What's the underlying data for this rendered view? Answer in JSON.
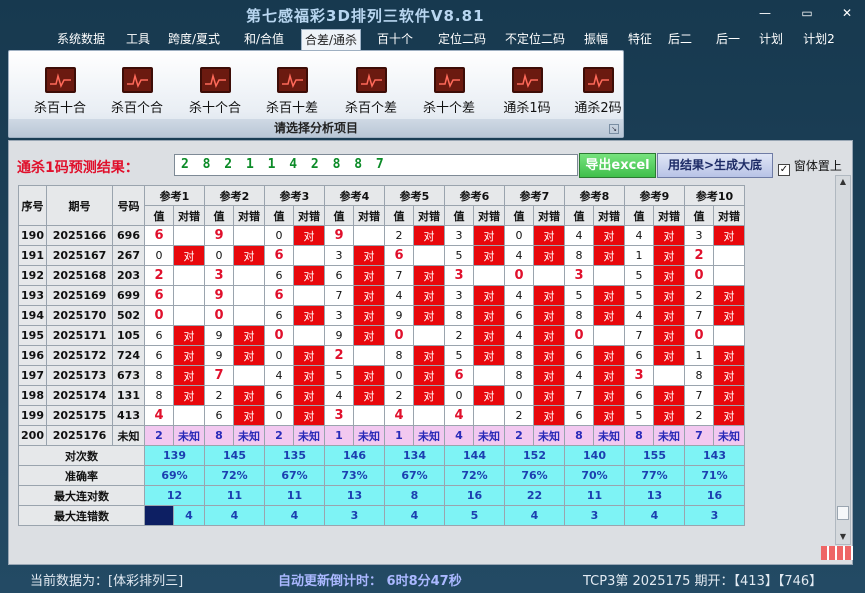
{
  "app": {
    "title": "第七感福彩3D排列三软件V8.81",
    "window_controls": [
      "—",
      "▭",
      "✕"
    ]
  },
  "menu": [
    {
      "label": "系统数据",
      "active": false
    },
    {
      "label": "工具",
      "active": false
    },
    {
      "label": "跨度/夏式",
      "active": false
    },
    {
      "label": "和/合值",
      "active": false
    },
    {
      "label": "合差/通杀",
      "active": true
    },
    {
      "label": "百十个",
      "active": false
    },
    {
      "label": "定位二码",
      "active": false
    },
    {
      "label": "不定位二码",
      "active": false
    },
    {
      "label": "振幅",
      "active": false
    },
    {
      "label": "特征",
      "active": false
    },
    {
      "label": "后二",
      "active": false
    },
    {
      "label": "后一",
      "active": false
    },
    {
      "label": "计划",
      "active": false
    },
    {
      "label": "计划2",
      "active": false
    }
  ],
  "ribbon": {
    "buttons": [
      "杀百十合",
      "杀百个合",
      "杀十个合",
      "杀百十差",
      "杀百个差",
      "杀十个差",
      "通杀1码",
      "通杀2码"
    ],
    "group_label": "请选择分析项目",
    "icon": "chart-icon"
  },
  "prediction": {
    "label": "通杀1码预测结果：",
    "digits": "2 8 2 1 1 4 2 8 8 7",
    "excel_button": "导出excel",
    "generate_button": "用结果>生成大底",
    "pin_checkbox": {
      "label": "窗体置上",
      "checked": true
    }
  },
  "table": {
    "headers": {
      "seq": "序号",
      "period": "期号",
      "code": "号码",
      "ref_prefix": "参考",
      "value": "值",
      "check": "对错"
    },
    "ref_groups": [
      "参考1",
      "参考2",
      "参考3",
      "参考4",
      "参考5",
      "参考6",
      "参考7",
      "参考8",
      "参考9",
      "参考10"
    ],
    "hit_label": "对",
    "rows": [
      {
        "seq": "190",
        "period": "2025166",
        "code": "696",
        "refs": [
          [
            "6",
            0
          ],
          [
            "9",
            0
          ],
          [
            "0",
            1
          ],
          [
            "9",
            0
          ],
          [
            "2",
            1
          ],
          [
            "3",
            1
          ],
          [
            "0",
            1
          ],
          [
            "4",
            1
          ],
          [
            "4",
            1
          ],
          [
            "3",
            1
          ]
        ]
      },
      {
        "seq": "191",
        "period": "2025167",
        "code": "267",
        "refs": [
          [
            "0",
            1
          ],
          [
            "0",
            1
          ],
          [
            "6",
            0
          ],
          [
            "3",
            1
          ],
          [
            "6",
            0
          ],
          [
            "5",
            1
          ],
          [
            "4",
            1
          ],
          [
            "8",
            1
          ],
          [
            "1",
            1
          ],
          [
            "2",
            0
          ]
        ]
      },
      {
        "seq": "192",
        "period": "2025168",
        "code": "203",
        "refs": [
          [
            "2",
            0
          ],
          [
            "3",
            0
          ],
          [
            "6",
            1
          ],
          [
            "6",
            1
          ],
          [
            "7",
            1
          ],
          [
            "3",
            0
          ],
          [
            "0",
            0
          ],
          [
            "3",
            0
          ],
          [
            "5",
            1
          ],
          [
            "0",
            0
          ]
        ]
      },
      {
        "seq": "193",
        "period": "2025169",
        "code": "699",
        "refs": [
          [
            "6",
            0
          ],
          [
            "9",
            0
          ],
          [
            "6",
            0
          ],
          [
            "7",
            1
          ],
          [
            "4",
            1
          ],
          [
            "3",
            1
          ],
          [
            "4",
            1
          ],
          [
            "5",
            1
          ],
          [
            "5",
            1
          ],
          [
            "2",
            1
          ]
        ]
      },
      {
        "seq": "194",
        "period": "2025170",
        "code": "502",
        "refs": [
          [
            "0",
            0
          ],
          [
            "0",
            0
          ],
          [
            "6",
            1
          ],
          [
            "3",
            1
          ],
          [
            "9",
            1
          ],
          [
            "8",
            1
          ],
          [
            "6",
            1
          ],
          [
            "8",
            1
          ],
          [
            "4",
            1
          ],
          [
            "7",
            1
          ]
        ]
      },
      {
        "seq": "195",
        "period": "2025171",
        "code": "105",
        "refs": [
          [
            "6",
            1
          ],
          [
            "9",
            1
          ],
          [
            "0",
            0
          ],
          [
            "9",
            1
          ],
          [
            "0",
            0
          ],
          [
            "2",
            1
          ],
          [
            "4",
            1
          ],
          [
            "0",
            0
          ],
          [
            "7",
            1
          ],
          [
            "0",
            0
          ]
        ]
      },
      {
        "seq": "196",
        "period": "2025172",
        "code": "724",
        "refs": [
          [
            "6",
            1
          ],
          [
            "9",
            1
          ],
          [
            "0",
            1
          ],
          [
            "2",
            0
          ],
          [
            "8",
            1
          ],
          [
            "5",
            1
          ],
          [
            "8",
            1
          ],
          [
            "6",
            1
          ],
          [
            "6",
            1
          ],
          [
            "1",
            1
          ]
        ]
      },
      {
        "seq": "197",
        "period": "2025173",
        "code": "673",
        "refs": [
          [
            "8",
            1
          ],
          [
            "7",
            0
          ],
          [
            "4",
            1
          ],
          [
            "5",
            1
          ],
          [
            "0",
            1
          ],
          [
            "6",
            0
          ],
          [
            "8",
            1
          ],
          [
            "4",
            1
          ],
          [
            "3",
            0
          ],
          [
            "8",
            1
          ]
        ]
      },
      {
        "seq": "198",
        "period": "2025174",
        "code": "131",
        "refs": [
          [
            "8",
            1
          ],
          [
            "2",
            1
          ],
          [
            "6",
            1
          ],
          [
            "4",
            1
          ],
          [
            "2",
            1
          ],
          [
            "0",
            1
          ],
          [
            "0",
            1
          ],
          [
            "7",
            1
          ],
          [
            "6",
            1
          ],
          [
            "7",
            1
          ]
        ]
      },
      {
        "seq": "199",
        "period": "2025175",
        "code": "413",
        "refs": [
          [
            "4",
            0
          ],
          [
            "6",
            1
          ],
          [
            "0",
            1
          ],
          [
            "3",
            0
          ],
          [
            "4",
            0
          ],
          [
            "4",
            0
          ],
          [
            "2",
            1
          ],
          [
            "6",
            1
          ],
          [
            "5",
            1
          ],
          [
            "2",
            1
          ]
        ]
      }
    ],
    "pending": {
      "seq": "200",
      "period": "2025176",
      "code": "未知",
      "values": [
        "2",
        "8",
        "2",
        "1",
        "1",
        "4",
        "2",
        "8",
        "8",
        "7"
      ],
      "check": "未知"
    },
    "stats": [
      {
        "label": "对次数",
        "values": [
          "139",
          "145",
          "135",
          "146",
          "134",
          "144",
          "152",
          "140",
          "155",
          "143"
        ]
      },
      {
        "label": "准确率",
        "values": [
          "69%",
          "72%",
          "67%",
          "73%",
          "67%",
          "72%",
          "76%",
          "70%",
          "77%",
          "71%"
        ]
      },
      {
        "label": "最大连对数",
        "values": [
          "12",
          "11",
          "11",
          "13",
          "8",
          "16",
          "22",
          "11",
          "13",
          "16"
        ]
      },
      {
        "label": "最大连错数",
        "values": [
          "4",
          "4",
          "4",
          "3",
          "4",
          "5",
          "4",
          "3",
          "4",
          "3"
        ]
      }
    ]
  },
  "status": {
    "current_data": "当前数据为：[体彩排列三]",
    "countdown": "自动更新倒计时：  6时8分47秒",
    "draw_info": "TCP3第 2025175 期开：【413】【746】"
  },
  "colors": {
    "hit_red": "#e8080c",
    "pending_pink": "#f2c8f0",
    "stats_cyan": "#7ef3f5",
    "title_bg": "#17394f"
  }
}
